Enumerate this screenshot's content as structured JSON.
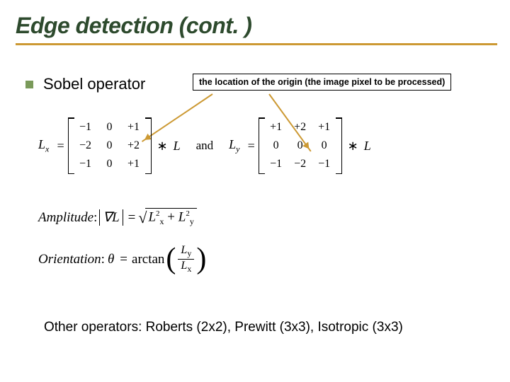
{
  "title": "Edge detection (cont. )",
  "bullet": {
    "text": "Sobel operator"
  },
  "origin_note": "the location of the origin (the image pixel to be processed)",
  "Lx": {
    "label": "L",
    "sub": "x",
    "m": [
      "−1",
      "0",
      "+1",
      "−2",
      "0",
      "+2",
      "−1",
      "0",
      "+1"
    ]
  },
  "and": "and",
  "Ly": {
    "label": "L",
    "sub": "y",
    "m": [
      "+1",
      "+2",
      "+1",
      "0",
      "0",
      "0",
      "−1",
      "−2",
      "−1"
    ]
  },
  "conv": "∗",
  "convArg": "L",
  "amplitude": {
    "label": "Amplitude",
    "colon": ":",
    "grad": "∇L",
    "lx": "L",
    "lxsub": "x",
    "ly": "L",
    "lysub": "y",
    "sq": "2",
    "plus": "+"
  },
  "orientation": {
    "label": "Orientation",
    "colon": ":",
    "theta": "θ",
    "fn": "arctan",
    "num": "L",
    "numsub": "y",
    "den": "L",
    "densub": "x"
  },
  "footer": "Other operators: Roberts (2x2), Prewitt (3x3), Isotropic (3x3)"
}
